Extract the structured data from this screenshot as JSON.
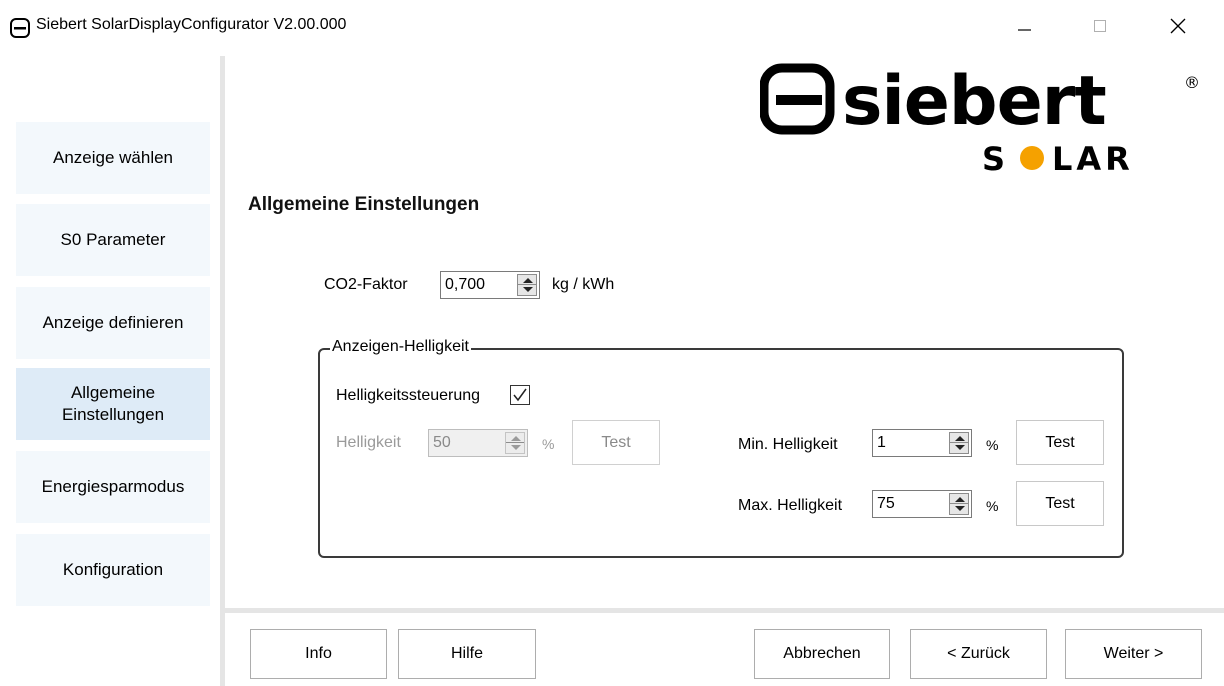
{
  "window": {
    "title": "Siebert SolarDisplayConfigurator V2.00.000"
  },
  "icons": {
    "app": "siebert-logo-icon",
    "minimize": "minimize-icon",
    "maximize": "maximize-icon",
    "close": "close-icon",
    "spin_up": "spin-up-icon",
    "spin_down": "spin-down-icon",
    "check": "checkmark-icon"
  },
  "sidebar": {
    "items": [
      {
        "label": "Anzeige wählen"
      },
      {
        "label": "S0 Parameter"
      },
      {
        "label": "Anzeige definieren"
      },
      {
        "label": "Allgemeine Einstellungen",
        "active": true
      },
      {
        "label": "Energiesparmodus"
      },
      {
        "label": "Konfiguration"
      }
    ]
  },
  "logo": {
    "brand": "siebert",
    "registered": "®",
    "sub": "SOLAR",
    "sub_accent_color": "#f5a100"
  },
  "main": {
    "title": "Allgemeine Einstellungen",
    "co2": {
      "label": "CO2-Faktor",
      "value": "0,700",
      "unit": "kg / kWh"
    },
    "brightness_group": {
      "legend": "Anzeigen-Helligkeit",
      "control_label": "Helligkeitssteuerung",
      "control_checked": true,
      "brightness": {
        "label": "Helligkeit",
        "value": "50",
        "unit": "%",
        "test_label": "Test",
        "disabled": true
      },
      "min": {
        "label": "Min. Helligkeit",
        "value": "1",
        "unit": "%",
        "test_label": "Test"
      },
      "max": {
        "label": "Max. Helligkeit",
        "value": "75",
        "unit": "%",
        "test_label": "Test"
      }
    }
  },
  "footer": {
    "info": "Info",
    "help": "Hilfe",
    "cancel": "Abbrechen",
    "back": "< Zurück",
    "next": "Weiter >"
  },
  "colors": {
    "nav_bg": "#f3f8fc",
    "nav_active_bg": "#deebf7",
    "separator": "#e5e5e5",
    "disabled_text": "#9a9a9a"
  }
}
